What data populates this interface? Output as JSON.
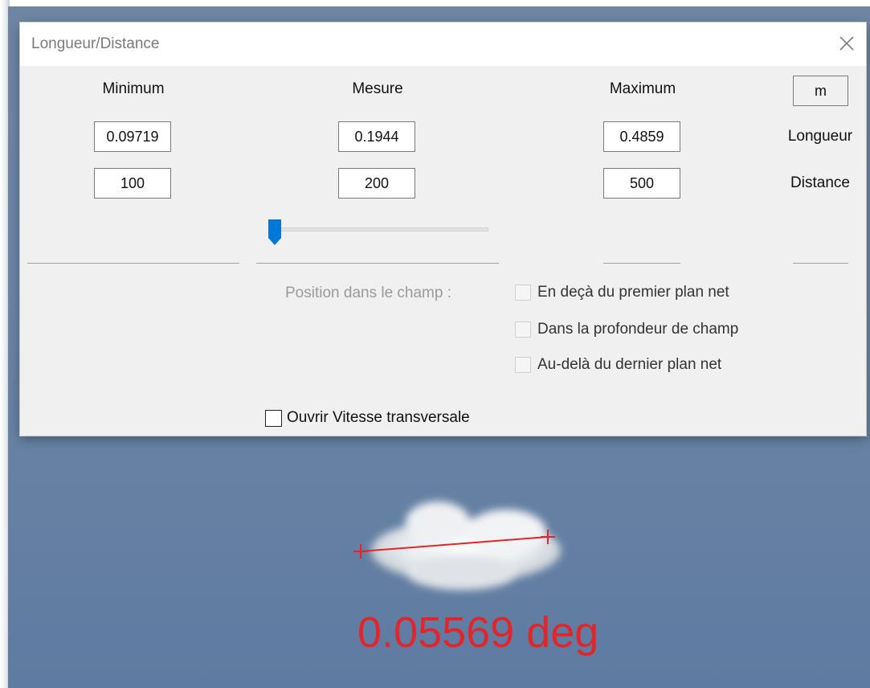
{
  "window": {
    "title": "Longueur/Distance"
  },
  "headers": {
    "minimum": "Minimum",
    "mesure": "Mesure",
    "maximum": "Maximum"
  },
  "unit": "m",
  "rows": {
    "longueur": {
      "label": "Longueur",
      "minimum": "0.09719",
      "mesure": "0.1944",
      "maximum": "0.4859"
    },
    "distance": {
      "label": "Distance",
      "minimum": "100",
      "mesure": "200",
      "maximum": "500"
    }
  },
  "slider": {
    "position_fraction": 0.0
  },
  "position": {
    "label": "Position dans le champ :",
    "options": [
      {
        "label": "En deçà du premier plan net",
        "checked": false,
        "enabled": false
      },
      {
        "label": "Dans la profondeur de champ",
        "checked": false,
        "enabled": false
      },
      {
        "label": "Au-delà du dernier plan net",
        "checked": false,
        "enabled": false
      }
    ]
  },
  "open_speed": {
    "label": "Ouvrir Vitesse transversale",
    "checked": false
  },
  "overlay": {
    "angle_text": "0.05569 deg",
    "color": "#e0262b"
  }
}
